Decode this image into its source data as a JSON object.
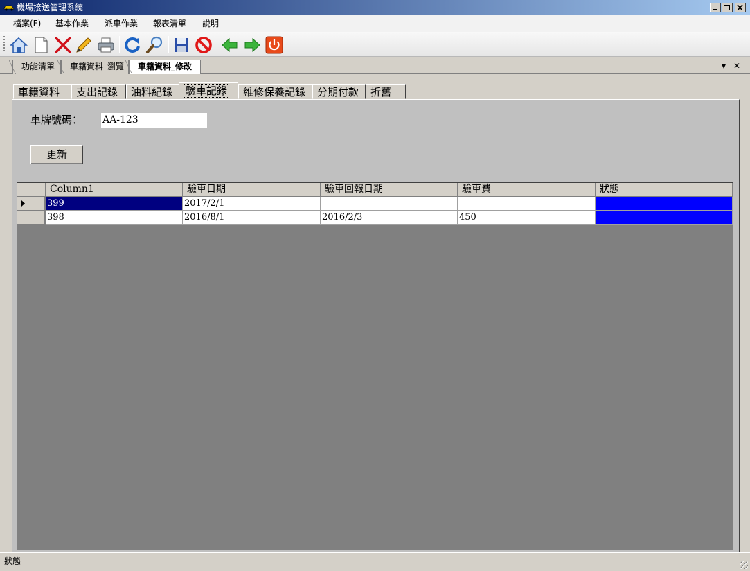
{
  "window": {
    "title": "機場接送管理系統"
  },
  "menu": [
    "檔案(F)",
    "基本作業",
    "派車作業",
    "報表清單",
    "說明"
  ],
  "toolbar": [
    "home-icon",
    "new-document-icon",
    "delete-icon",
    "edit-icon",
    "print-icon",
    "refresh-icon",
    "search-icon",
    "save-icon",
    "stop-icon",
    "back-icon",
    "forward-icon",
    "power-icon"
  ],
  "doc_tabs": [
    "功能清單",
    "車籍資料_瀏覽",
    "車籍資料_修改"
  ],
  "doc_controls": {
    "dropdown": "▾",
    "close": "✕"
  },
  "sub_tabs": [
    "車籍資料",
    "支出記錄",
    "油料紀錄",
    "驗車記錄",
    "維修保養記錄",
    "分期付款",
    "折舊"
  ],
  "active_sub_tab": "驗車記錄",
  "form": {
    "plate_label": "車牌號碼：",
    "plate_value": "AA-123",
    "update_button": "更新"
  },
  "grid": {
    "columns": [
      "Column1",
      "驗車日期",
      "驗車回報日期",
      "驗車費",
      "狀態"
    ],
    "rows": [
      [
        "399",
        "2017/2/1",
        "",
        "",
        ""
      ],
      [
        "398",
        "2016/8/1",
        "2016/2/3",
        "450",
        ""
      ]
    ]
  },
  "status_bar": {
    "text": "狀態"
  },
  "colors": {
    "selected_cell": "#000080",
    "status_cell": "#0000ff",
    "grid_background": "#808080"
  }
}
